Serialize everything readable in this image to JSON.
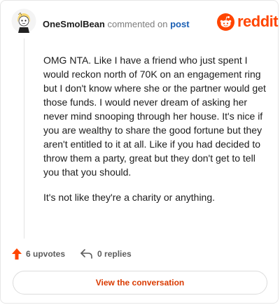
{
  "comment": {
    "username": "OneSmolBean",
    "action_text": "commented on",
    "post_link": "post",
    "paragraphs": [
      "OMG NTA. Like I have a friend who just spent I would reckon north of 70K on an engagement ring but I don't know where she or the partner would get those funds. I would never dream of asking her never mind snooping through her house. It's nice if you are wealthy to share the good fortune but they aren't entitled to it at all. Like if you had decided to throw them a party, great but they don't get to tell you that you should.",
      "It's not like they're a charity or anything."
    ],
    "upvotes": "6 upvotes",
    "replies": "0 replies"
  },
  "brand": {
    "logo_text": "reddit",
    "icon": "reddit-snoo-icon",
    "color": "#ff4500"
  },
  "cta": {
    "label": "View the conversation"
  },
  "colors": {
    "upvote": "#ff4500",
    "link": "#1a5fb4",
    "cta_text": "#d93a00"
  },
  "icons": {
    "avatar": "snoo-avatar",
    "upvote": "upvote-arrow-icon",
    "reply": "reply-arrow-icon"
  }
}
